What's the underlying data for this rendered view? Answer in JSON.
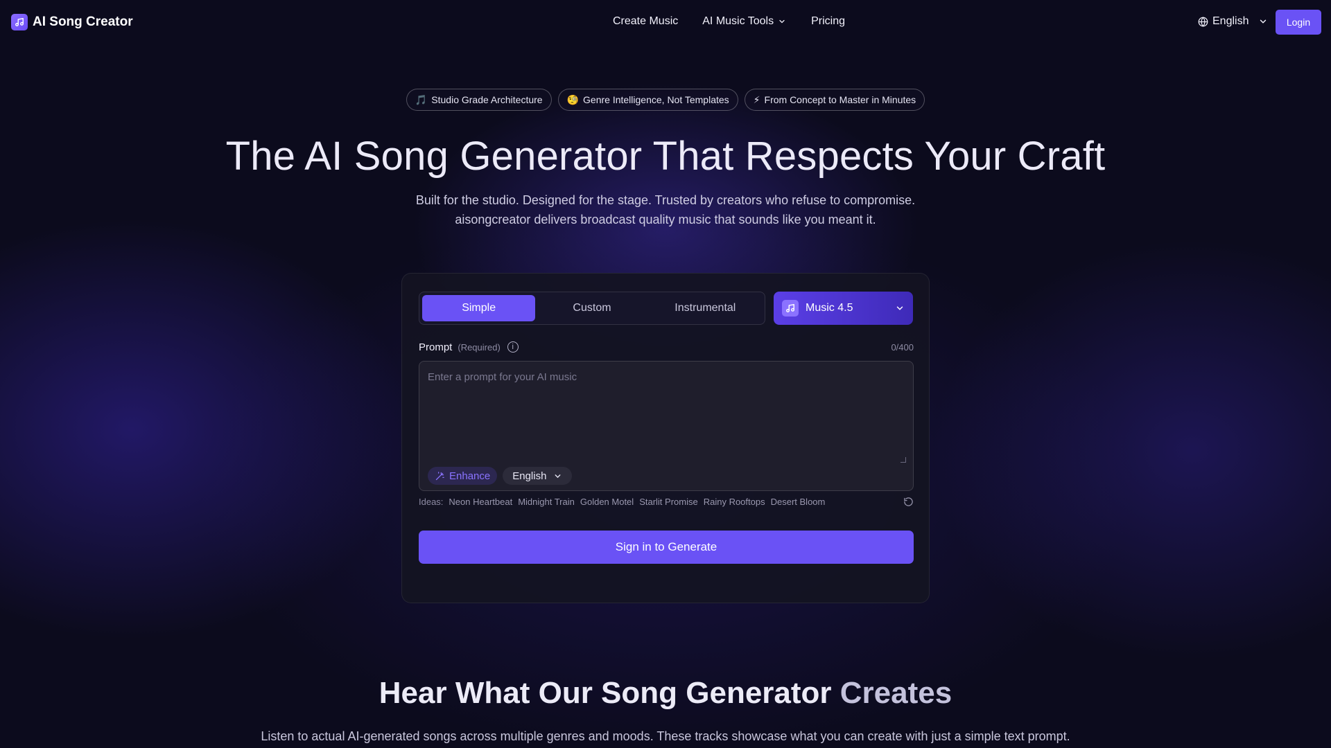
{
  "header": {
    "logo_text": "AI Song Creator",
    "logo_icon": "music-note-icon",
    "nav": [
      {
        "label": "Create Music"
      },
      {
        "label": "AI Music Tools"
      },
      {
        "label": "Pricing"
      }
    ],
    "language_label": "English",
    "login_label": "Login"
  },
  "hero": {
    "badges": [
      {
        "emoji": "🎵",
        "label": "Studio Grade Architecture"
      },
      {
        "emoji": "🧐",
        "label": "Genre Intelligence, Not Templates"
      },
      {
        "emoji": "⚡",
        "label": "From Concept to Master in Minutes"
      }
    ],
    "title": "The AI Song Generator That Respects Your Craft",
    "subtitle": "Built for the studio. Designed for the stage. Trusted by creators who refuse to compromise. aisongcreator delivers broadcast quality music that sounds like you meant it."
  },
  "generator": {
    "tabs": [
      {
        "label": "Simple",
        "active": true
      },
      {
        "label": "Custom",
        "active": false
      },
      {
        "label": "Instrumental",
        "active": false
      }
    ],
    "model_label": "Music 4.5",
    "prompt_label": "Prompt",
    "prompt_required": "(Required)",
    "counter": "0/400",
    "prompt_placeholder": "Enter a prompt for your AI music",
    "prompt_value": "",
    "enhance_label": "Enhance",
    "language_label": "English",
    "ideas_label": "Ideas:",
    "ideas": [
      "Neon Heartbeat",
      "Midnight Train",
      "Golden Motel",
      "Starlit Promise",
      "Rainy Rooftops",
      "Desert Bloom"
    ],
    "generate_label": "Sign in to Generate"
  },
  "showcase": {
    "title_main": "Hear What Our Song Generator",
    "title_fade": "Creates",
    "subtitle": "Listen to actual AI-generated songs across multiple genres and moods. These tracks showcase what you can create with just a simple text prompt."
  },
  "colors": {
    "accent": "#6a52f5",
    "background": "#0c0b1d",
    "card": "#14131f"
  }
}
